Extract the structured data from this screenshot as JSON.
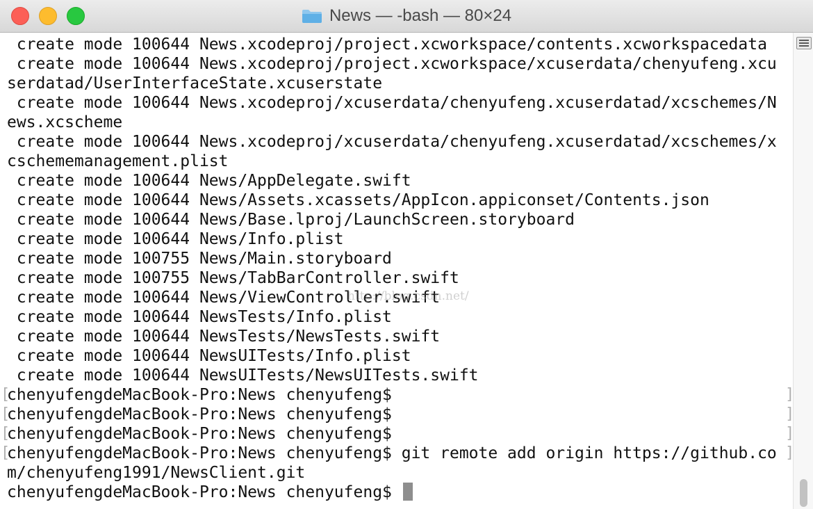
{
  "window": {
    "title": "News — -bash — 80×24",
    "folder_icon": "folder-icon",
    "controls": [
      "close",
      "minimize",
      "zoom"
    ]
  },
  "terminal": {
    "lines": [
      " create mode 100644 News.xcodeproj/project.xcworkspace/contents.xcworkspacedata",
      " create mode 100644 News.xcodeproj/project.xcworkspace/xcuserdata/chenyufeng.xcu",
      "serdatad/UserInterfaceState.xcuserstate",
      " create mode 100644 News.xcodeproj/xcuserdata/chenyufeng.xcuserdatad/xcschemes/N",
      "ews.xcscheme",
      " create mode 100644 News.xcodeproj/xcuserdata/chenyufeng.xcuserdatad/xcschemes/x",
      "cschememanagement.plist",
      " create mode 100644 News/AppDelegate.swift",
      " create mode 100644 News/Assets.xcassets/AppIcon.appiconset/Contents.json",
      " create mode 100644 News/Base.lproj/LaunchScreen.storyboard",
      " create mode 100644 News/Info.plist",
      " create mode 100755 News/Main.storyboard",
      " create mode 100755 News/TabBarController.swift",
      " create mode 100644 News/ViewController.swift",
      " create mode 100644 NewsTests/Info.plist",
      " create mode 100644 NewsTests/NewsTests.swift",
      " create mode 100644 NewsUITests/Info.plist",
      " create mode 100644 NewsUITests/NewsUITests.swift",
      "chenyufengdeMacBook-Pro:News chenyufeng$",
      "chenyufengdeMacBook-Pro:News chenyufeng$",
      "chenyufengdeMacBook-Pro:News chenyufeng$",
      "chenyufengdeMacBook-Pro:News chenyufeng$ git remote add origin https://github.co",
      "m/chenyufeng1991/NewsClient.git",
      "chenyufengdeMacBook-Pro:News chenyufeng$ "
    ],
    "bracket_open": "[",
    "bracket_close": "]",
    "watermark": "http://blog.csdn.net/"
  },
  "colors": {
    "close": "#fc5f57",
    "minimize": "#fdbc2e",
    "zoom": "#28c840",
    "text": "#111111",
    "cursor": "#8e8e8e"
  }
}
